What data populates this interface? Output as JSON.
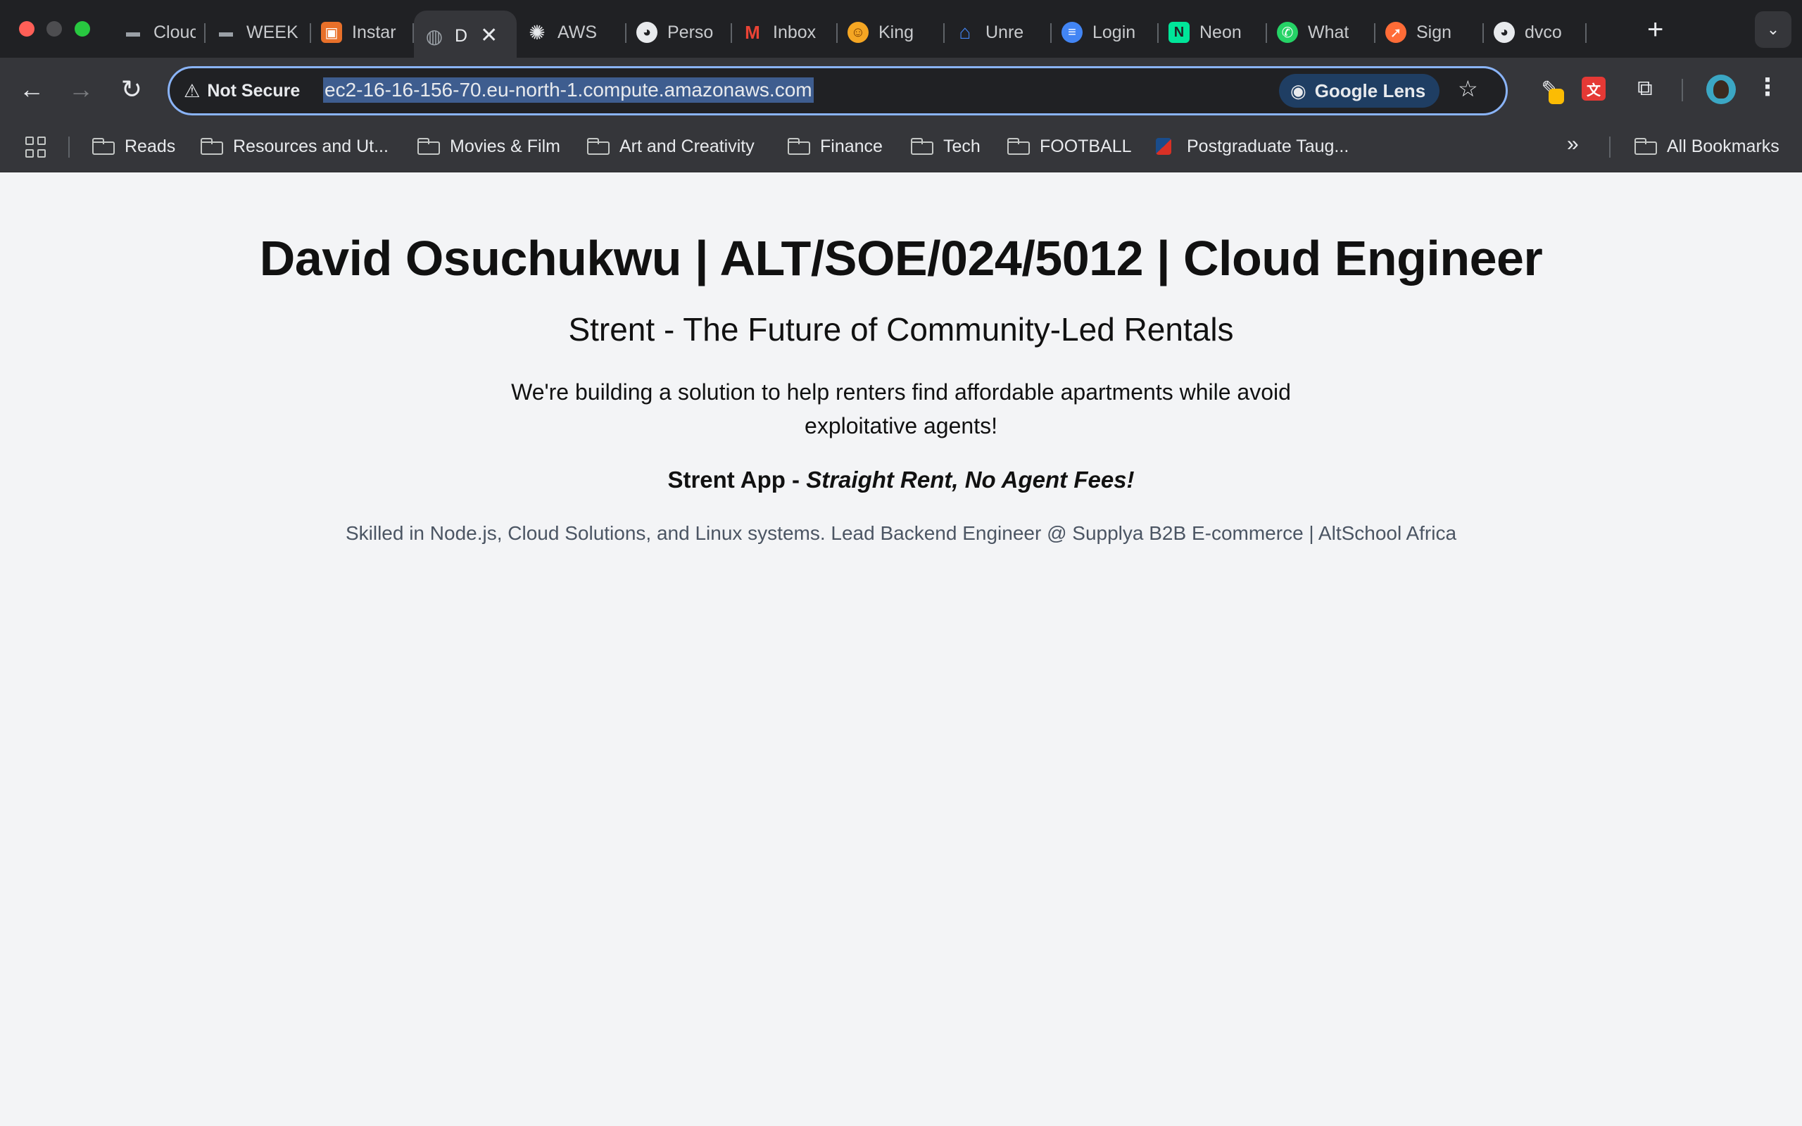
{
  "browser": {
    "tabs": [
      {
        "title": "Clouc",
        "icon": "folder-tab-icon",
        "color": "#202124"
      },
      {
        "title": "WEEK",
        "icon": "folder-tab-icon",
        "color": "#202124"
      },
      {
        "title": "Instar",
        "icon": "aws-console-icon",
        "color": "#e8702a"
      },
      {
        "title": "D",
        "icon": "globe-icon",
        "color": "#9aa0a6",
        "active": true
      },
      {
        "title": "AWS",
        "icon": "chatgpt-icon",
        "color": "#202124"
      },
      {
        "title": "Perso",
        "icon": "github-icon",
        "color": "#202124"
      },
      {
        "title": "Inbox",
        "icon": "gmail-icon",
        "color": "#ea4335"
      },
      {
        "title": "King",
        "icon": "king-icon",
        "color": "#f5a623"
      },
      {
        "title": "Unre",
        "icon": "mail-icon",
        "color": "#4285f4"
      },
      {
        "title": "Login",
        "icon": "globe-stripes-icon",
        "color": "#4285f4"
      },
      {
        "title": "Neon",
        "icon": "neon-icon",
        "color": "#00e599"
      },
      {
        "title": "What",
        "icon": "whatsapp-icon",
        "color": "#25d366"
      },
      {
        "title": "Sign",
        "icon": "postman-icon",
        "color": "#ff6c37"
      },
      {
        "title": "dvco",
        "icon": "github-icon",
        "color": "#202124"
      }
    ],
    "close_tab_glyph": "✕",
    "new_tab_glyph": "+",
    "tab_search_glyph": "⌄",
    "security_label": "Not Secure",
    "url": "ec2-16-16-156-70.eu-north-1.compute.amazonaws.com",
    "google_lens_label": "Google Lens",
    "bookmarks": [
      {
        "label": "Reads",
        "icon": "folder-icon"
      },
      {
        "label": "Resources and Ut...",
        "icon": "folder-icon"
      },
      {
        "label": "Movies & Film",
        "icon": "folder-icon"
      },
      {
        "label": "Art and Creativity",
        "icon": "folder-icon"
      },
      {
        "label": "Finance",
        "icon": "folder-icon"
      },
      {
        "label": "Tech",
        "icon": "folder-icon"
      },
      {
        "label": "FOOTBALL",
        "icon": "folder-icon"
      },
      {
        "label": "Postgraduate Taug...",
        "icon": "site-favicon-icon"
      }
    ],
    "all_bookmarks_label": "All Bookmarks"
  },
  "page": {
    "heading": "David Osuchukwu | ALT/SOE/024/5012 | Cloud Engineer",
    "subheading": "Strent - The Future of Community-Led Rentals",
    "intro": "We're building a solution to help renters find affordable apartments while avoid exploitative agents!",
    "app_name": "Strent App - ",
    "app_tagline": "Straight Rent, No Agent Fees!",
    "skills": "Skilled in Node.js, Cloud Solutions, and Linux systems. Lead Backend Engineer @ Supplya B2B E-commerce | AltSchool Africa"
  },
  "colors": {
    "page_background": "#f3f4f6",
    "muted_text": "#4b5563",
    "omnibox_focus": "#8ab4f8"
  }
}
